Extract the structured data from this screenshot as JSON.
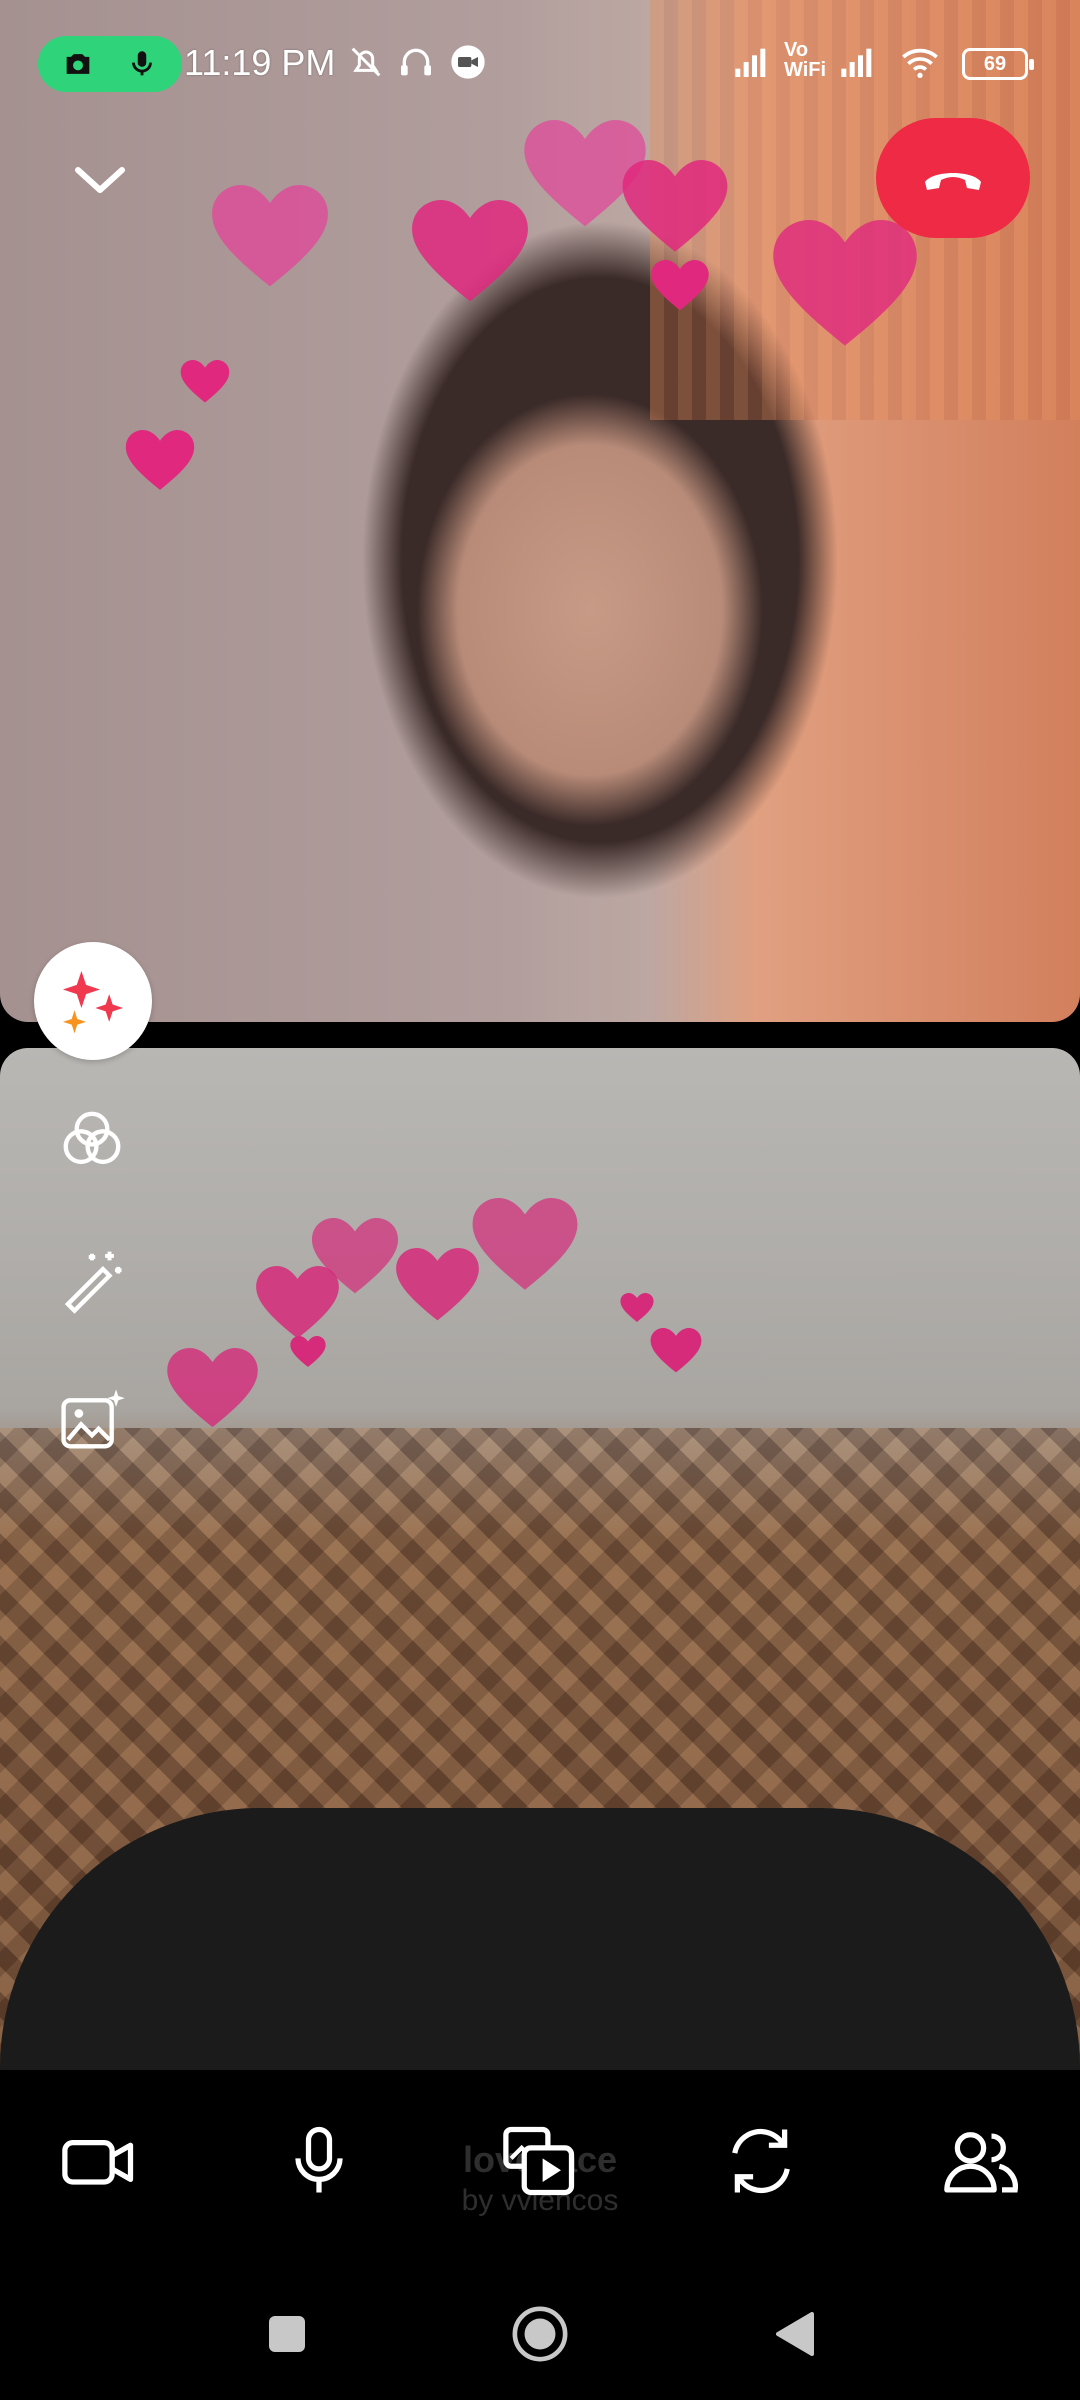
{
  "status_bar": {
    "time": "11:19 PM",
    "vowifi_label": "Vo WiFi",
    "battery_level": "69",
    "pill_color": "#2fd37a"
  },
  "top_controls": {
    "collapse_icon": "chevron-down-icon",
    "end_call_icon": "phone-hangup-icon",
    "end_call_color": "#ee2a45"
  },
  "effects": {
    "active_effect_name": "love face",
    "active_effect_author": "by vviencos",
    "tools": [
      "sparkle-effects-icon",
      "color-filter-icon",
      "magic-wand-icon",
      "image-background-icon"
    ]
  },
  "controls": {
    "video_icon": "video-camera-icon",
    "mic_icon": "microphone-icon",
    "media_icon": "media-share-icon",
    "flip_icon": "flip-camera-icon",
    "people_icon": "participants-icon"
  },
  "nav": {
    "buttons": [
      "recents-square-icon",
      "home-circle-icon",
      "back-triangle-icon"
    ]
  }
}
